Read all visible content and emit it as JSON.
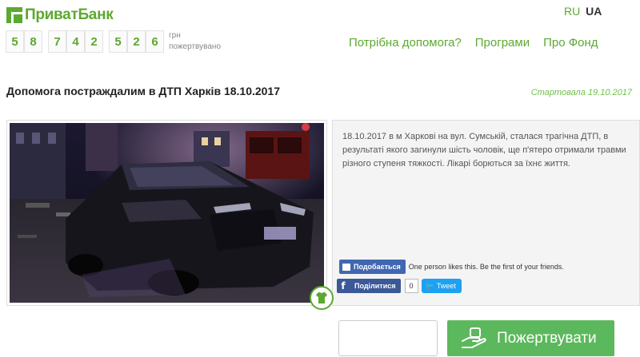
{
  "header": {
    "logo_text": "ПриватБанк",
    "lang_ru": "RU",
    "lang_ua": "UA"
  },
  "counter": {
    "digits": [
      "5",
      "8",
      "7",
      "4",
      "2",
      "5",
      "2",
      "6"
    ],
    "label_line1": "грн",
    "label_line2": "пожертвувано"
  },
  "nav": {
    "items": [
      "Потрібна допомога?",
      "Програми",
      "Про Фонд"
    ]
  },
  "campaign": {
    "title": "Допомога постраждалим в ДТП Харків 18.10.2017",
    "started": "Стартовала 19.10.2017",
    "description": "18.10.2017 в м Харкові на вул. Сумській, сталася трагічна ДТП, в результаті якого загинули шість чоловік, ще п'ятеро отримали травми різного ступеня тяжкості. Лікарі борються за їхнє життя."
  },
  "social": {
    "like_label": "Подобається",
    "like_text": "One person likes this. Be the first of your friends.",
    "share_label": "Поділитися",
    "share_count": "0",
    "tweet_label": "Tweet"
  },
  "donation": {
    "button_label": "Пожертвувати",
    "amount_value": ""
  },
  "colors": {
    "brand_green": "#5da831",
    "button_green": "#5cb85c",
    "facebook_blue": "#4267b2",
    "twitter_blue": "#1da1f2"
  }
}
